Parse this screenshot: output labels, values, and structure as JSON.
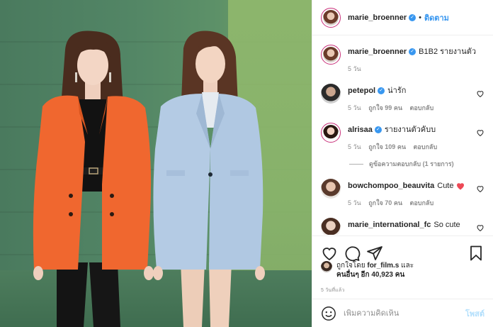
{
  "header": {
    "username": "marie_broenner",
    "separator": "•",
    "follow_label": "ติดตาม"
  },
  "caption": {
    "username": "marie_broenner",
    "text": "B1B2 รายงานตัว",
    "time": "5 วัน"
  },
  "comments": [
    {
      "username": "petepol",
      "verified": true,
      "text": "น่ารัก",
      "time": "5 วัน",
      "likes": "ถูกใจ 99 คน",
      "reply": "ตอบกลับ"
    },
    {
      "username": "alrisaa",
      "verified": true,
      "text": "รายงานตัวคับบ",
      "time": "5 วัน",
      "likes": "ถูกใจ 109 คน",
      "reply": "ตอบกลับ"
    },
    {
      "username": "bowchompoo_beauvita",
      "verified": false,
      "text": "Cute",
      "time": "5 วัน",
      "likes": "ถูกใจ 70 คน",
      "reply": "ตอบกลับ"
    },
    {
      "username": "marie_international_fc",
      "verified": false,
      "text": "So cute"
    }
  ],
  "view_replies": "ดูข้อความตอบกลับ (1 รายการ)",
  "likes_line1": "ถูกใจโดย",
  "likes_user": "for_film.s",
  "likes_and": "และ",
  "likes_line2_bold": "คนอื่นๆ อีก 40,923 คน",
  "post_time": "5 วันที่แล้ว",
  "composer": {
    "placeholder": "เพิ่มความคิดเห็น",
    "post_label": "โพสต์"
  },
  "colors": {
    "accent": "#3897f0",
    "post_disabled": "#b2dffc",
    "heart_red": "#ed4956"
  },
  "icons": [
    "heart-icon",
    "comment-icon",
    "share-icon",
    "bookmark-icon",
    "emoji-icon",
    "verified-icon",
    "red-heart-emoji"
  ]
}
